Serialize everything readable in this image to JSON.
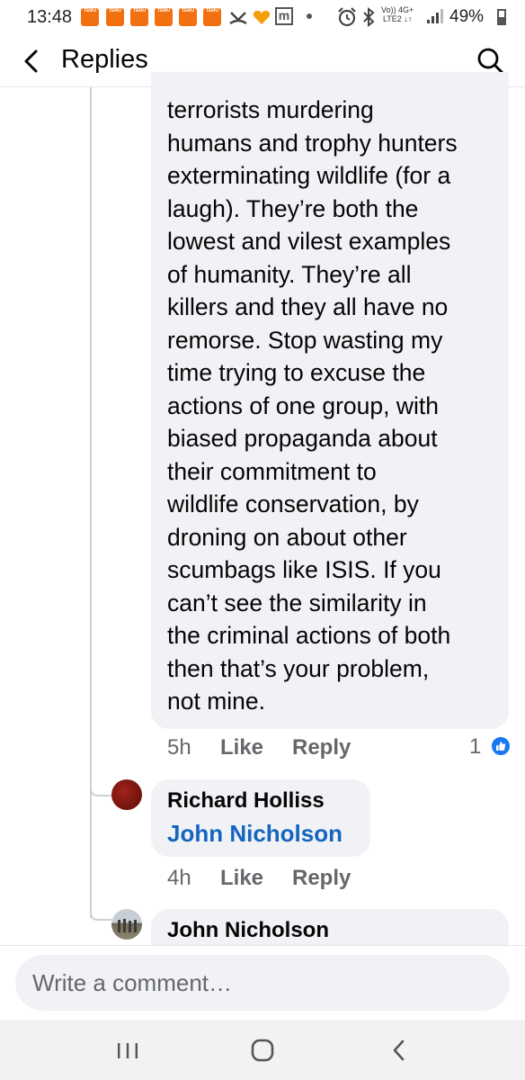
{
  "status_bar": {
    "time": "13:48",
    "temu_label": "TEMU",
    "temu_count": 6,
    "network_top": "Vo))  4G+",
    "network_bottom": "LTE2 ↓↑",
    "battery": "49%",
    "battery_level": 0.49,
    "icons": [
      "temu-app-icon",
      "missed-call-icon",
      "heart-icon",
      "m-app-icon",
      "dot-icon",
      "alarm-icon",
      "bluetooth-icon",
      "signal-icon",
      "battery-icon"
    ]
  },
  "header": {
    "title": "Replies",
    "back_icon": "chevron-left-icon",
    "search_icon": "search-icon"
  },
  "main_comment": {
    "text": "terrorists murdering\nhumans and trophy hunters\nexterminating wildlife (for a\nlaugh). They’re both the\nlowest and vilest examples\nof humanity. They’re all\nkillers and they all have no\nremorse. Stop wasting my\ntime trying to excuse the\nactions of one group, with\nbiased propaganda about\ntheir commitment to\nwildlife conservation, by\ndroning on about other\nscumbags like ISIS. If you\ncan’t see the similarity in\nthe criminal actions of both\nthen that’s your problem,\nnot mine.",
    "time": "5h",
    "like_label": "Like",
    "reply_label": "Reply",
    "reaction_count": "1",
    "reaction_icon": "like-reaction-icon"
  },
  "replies": [
    {
      "author": "Richard Holliss",
      "mention": "John Nicholson",
      "time": "4h",
      "like_label": "Like",
      "reply_label": "Reply"
    },
    {
      "author": "John Nicholson"
    }
  ],
  "comment_box": {
    "placeholder": "Write a comment…"
  },
  "nav_bar": {
    "icons": [
      "recent-apps-icon",
      "home-icon",
      "back-icon"
    ]
  },
  "colors": {
    "bubble": "#f0f2f5",
    "mention": "#1565c0",
    "secondary_text": "#65676b",
    "like_badge": "#1877f2",
    "temu": "#f2700f"
  }
}
